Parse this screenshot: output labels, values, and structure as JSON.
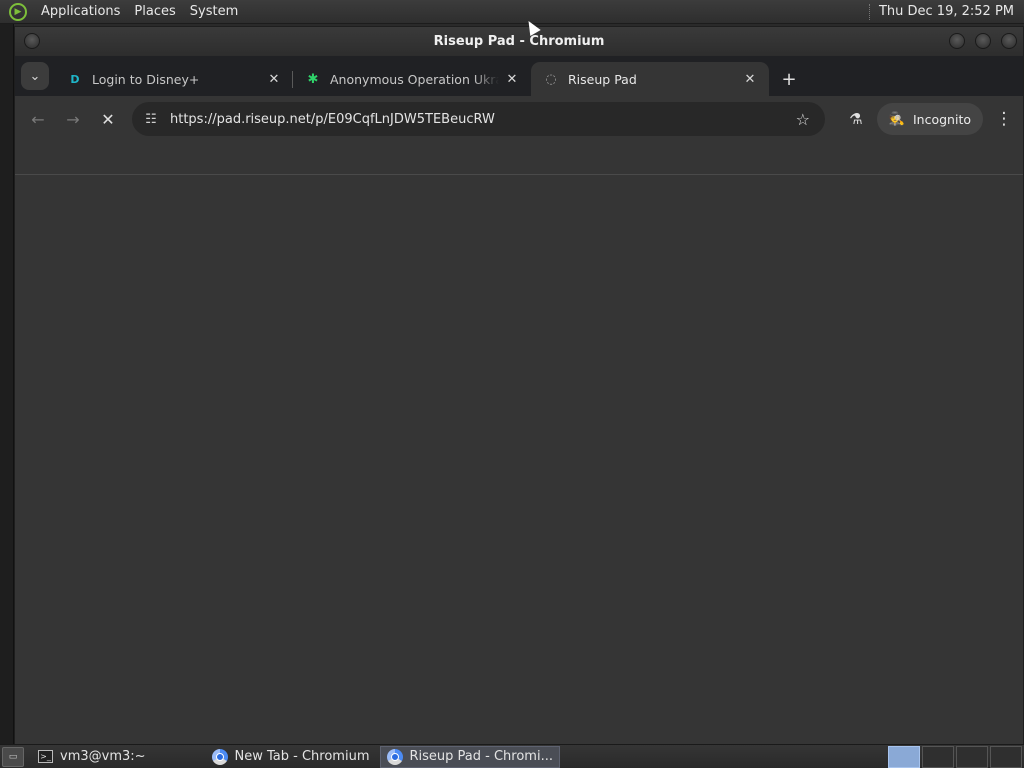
{
  "top_panel": {
    "menus": [
      "Applications",
      "Places",
      "System"
    ],
    "clock": "Thu Dec 19,  2:52 PM"
  },
  "window": {
    "title": "Riseup Pad - Chromium"
  },
  "tabs": [
    {
      "title": "Login to Disney+",
      "favicon": "disney-plus-icon",
      "active": false
    },
    {
      "title": "Anonymous Operation Ukraine",
      "favicon": "green-star-icon",
      "active": false
    },
    {
      "title": "Riseup Pad",
      "favicon": "riseup-loading-icon",
      "active": true
    }
  ],
  "toolbar": {
    "url": "https://pad.riseup.net/p/E09CqfLnJDW5TEBeucRW",
    "incognito_label": "Incognito"
  },
  "taskbar": {
    "tasks": [
      {
        "label": "vm3@vm3:~",
        "icon": "terminal-icon",
        "active": false
      },
      {
        "label": "New Tab - Chromium",
        "icon": "chromium-icon",
        "active": false
      },
      {
        "label": "Riseup Pad - Chromi...",
        "icon": "chromium-icon",
        "active": true
      }
    ]
  },
  "colors": {
    "chrome_frame": "#202124",
    "toolbar": "#353535",
    "omnibox": "#282828"
  }
}
